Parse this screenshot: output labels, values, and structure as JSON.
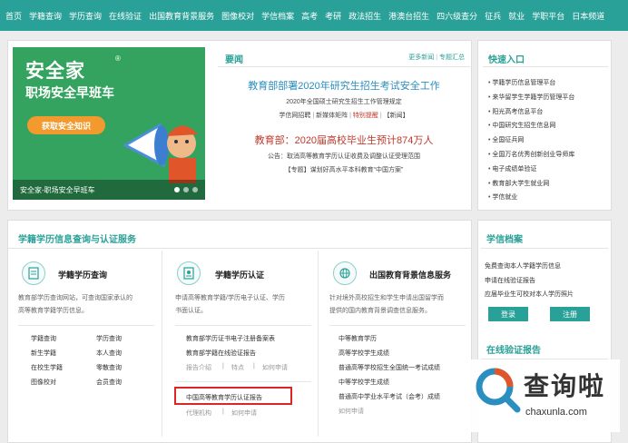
{
  "nav": [
    "首页",
    "学籍查询",
    "学历查询",
    "在线验证",
    "出国教育背景服务",
    "图像校对",
    "学信档案",
    "高考",
    "考研",
    "政法招生",
    "港澳台招生",
    "四六级查分",
    "征兵",
    "就业",
    "学职平台",
    "日本频道"
  ],
  "banner": {
    "logo": "安全家",
    "reg": "®",
    "slogan": "职场安全早班车",
    "cta": "获取安全知识",
    "caption": "安全家-职场安全早班车"
  },
  "news": {
    "title": "要闻",
    "more": "更多新闻",
    "topics": "专题汇总",
    "headline1": "教育部部署2020年研究生招生考试安全工作",
    "line1": "2020年全国硕士研究生招生工作管理规定",
    "line2": [
      "学信网招聘",
      "新媒体矩阵",
      "特别提醒",
      "【新闻】"
    ],
    "headline2": "教育部：2020届高校毕业生预计874万人",
    "line3": "公告：取消高等教育学历认证收费及调整认证受理范围",
    "line4": "【专题】谋划好高水平本科教育“中国方案”"
  },
  "quick": {
    "title": "快速入口",
    "items": [
      "学籍学历信息管理平台",
      "来华留学生学籍学历管理平台",
      "阳光高考信息平台",
      "中国研究生招生信息网",
      "全国征兵网",
      "全国万名优秀创新创业导师库",
      "电子成绩单验证",
      "教育部大学生就业网",
      "学信就业"
    ]
  },
  "services": {
    "title": "学籍学历信息查询与认证服务",
    "col1": {
      "title": "学籍学历查询",
      "desc": [
        "教育部学历查询网站，可查询国家承认的",
        "高等教育学籍学历信息。"
      ],
      "links": [
        "学籍查询",
        "学历查询",
        "新生学籍",
        "本人查询",
        "在校生学籍",
        "零散查询",
        "图像校对",
        "会员查询"
      ]
    },
    "col2": {
      "title": "学籍学历认证",
      "desc": [
        "申请高等教育学籍/学历电子认证、学历",
        "书面认证。"
      ],
      "links": [
        "教育部学历证书电子注册备案表",
        "教育部学籍在线验证报告"
      ],
      "sub1": [
        "报告介绍",
        "特点",
        "如何申请"
      ],
      "highlight": "中国高等教育学历认证报告",
      "sub2": [
        "代理机构",
        "如何申请"
      ]
    },
    "col3": {
      "title": "出国教育背景信息服务",
      "desc": [
        "针对境外高校招生和学生申请出国留学而",
        "提供的国内教育背景调查信息服务。"
      ],
      "links": [
        "中等教育学历",
        "高等学校学生成绩",
        "普通高等学校招生全国统一考试成绩",
        "中等学校学生成绩",
        "普通高中学业水平考试（会考）成绩"
      ],
      "sub": "如何申请"
    }
  },
  "archive": {
    "title": "学信档案",
    "items": [
      "免费查询本人学籍学历信息",
      "申请在线验证报告",
      "应届毕业生可校对本人学历照片"
    ],
    "login": "登录",
    "register": "注册"
  },
  "verify": {
    "title": "在线验证报告"
  },
  "watermark": {
    "name": "查询啦",
    "url": "chaxunla.com"
  },
  "colors": {
    "brand": "#2aa198",
    "accent_red": "#c0392b",
    "link_blue": "#2a8ec0",
    "banner_green": "#34a35f"
  }
}
